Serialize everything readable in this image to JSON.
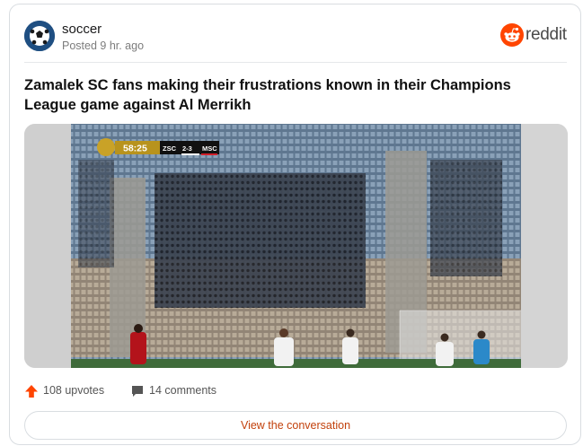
{
  "post": {
    "subreddit": "soccer",
    "posted": "Posted 9 hr. ago",
    "brand": "reddit",
    "title": "Zamalek SC fans making their frustrations known in their Champions League game against Al Merrikh"
  },
  "scoreboard": {
    "clock": "58:25",
    "home": "ZSC",
    "score": "2-3",
    "away": "MSC"
  },
  "actions": {
    "upvotes": "108 upvotes",
    "comments": "14 comments"
  },
  "footer": {
    "view_conversation": "View the conversation"
  },
  "colors": {
    "reddit_orange": "#ff4500",
    "link_orange": "#c2410c",
    "avatar_blue": "#1f4f82"
  },
  "icons": [
    "soccer-ball-icon",
    "reddit-logo-icon",
    "upvote-arrow-icon",
    "comment-bubble-icon"
  ]
}
